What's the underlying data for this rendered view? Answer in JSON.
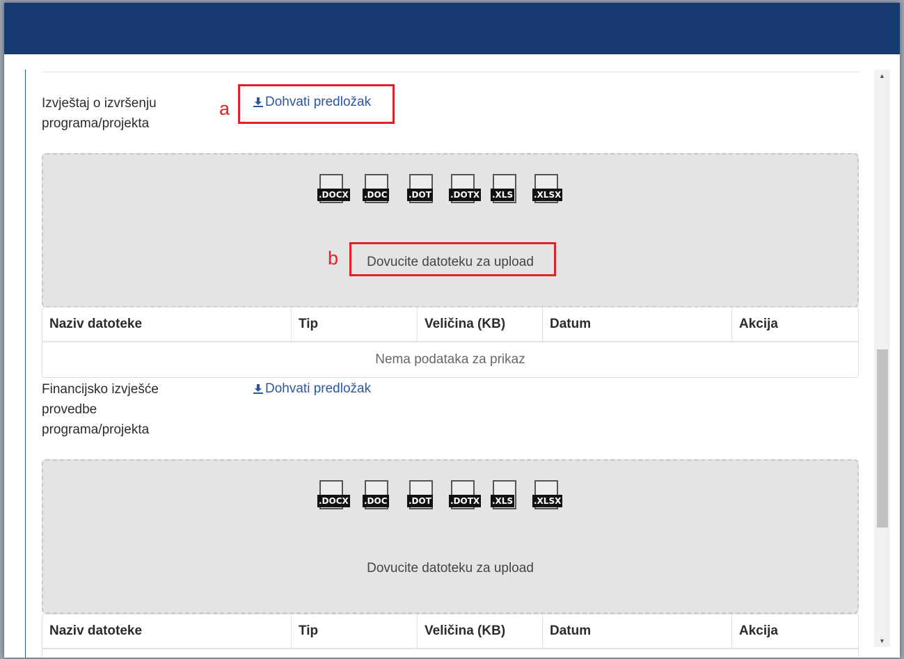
{
  "sections": [
    {
      "label_lines": [
        "Izvještaj o izvršenju",
        "programa/projekta"
      ],
      "template_link": "Dohvati predložak",
      "annotation_link_letter": "a",
      "annotation_drop_letter": "b",
      "filetypes": [
        ".DOCX",
        ".DOC",
        ".DOT",
        ".DOTX",
        ".XLS",
        ".XLSX"
      ],
      "drop_text": "Dovucite datoteku za upload",
      "table": {
        "headers": [
          "Naziv datoteke",
          "Tip",
          "Veličina (KB)",
          "Datum",
          "Akcija"
        ],
        "empty_text": "Nema podataka za prikaz"
      }
    },
    {
      "label_lines": [
        "Financijsko izvješće",
        "provedbe",
        "programa/projekta"
      ],
      "template_link": "Dohvati predložak",
      "filetypes": [
        ".DOCX",
        ".DOC",
        ".DOT",
        ".DOTX",
        ".XLS",
        ".XLSX"
      ],
      "drop_text": "Dovucite datoteku za upload",
      "table": {
        "headers": [
          "Naziv datoteke",
          "Tip",
          "Veličina (KB)",
          "Datum",
          "Akcija"
        ]
      }
    }
  ],
  "icons": {
    "download": "download-icon",
    "scroll_up": "arrow-up-icon",
    "scroll_down": "arrow-down-icon"
  },
  "colors": {
    "header": "#173b71",
    "link": "#2a57a3",
    "annotation": "#e0202a",
    "dropzone": "#e4e4e4"
  }
}
